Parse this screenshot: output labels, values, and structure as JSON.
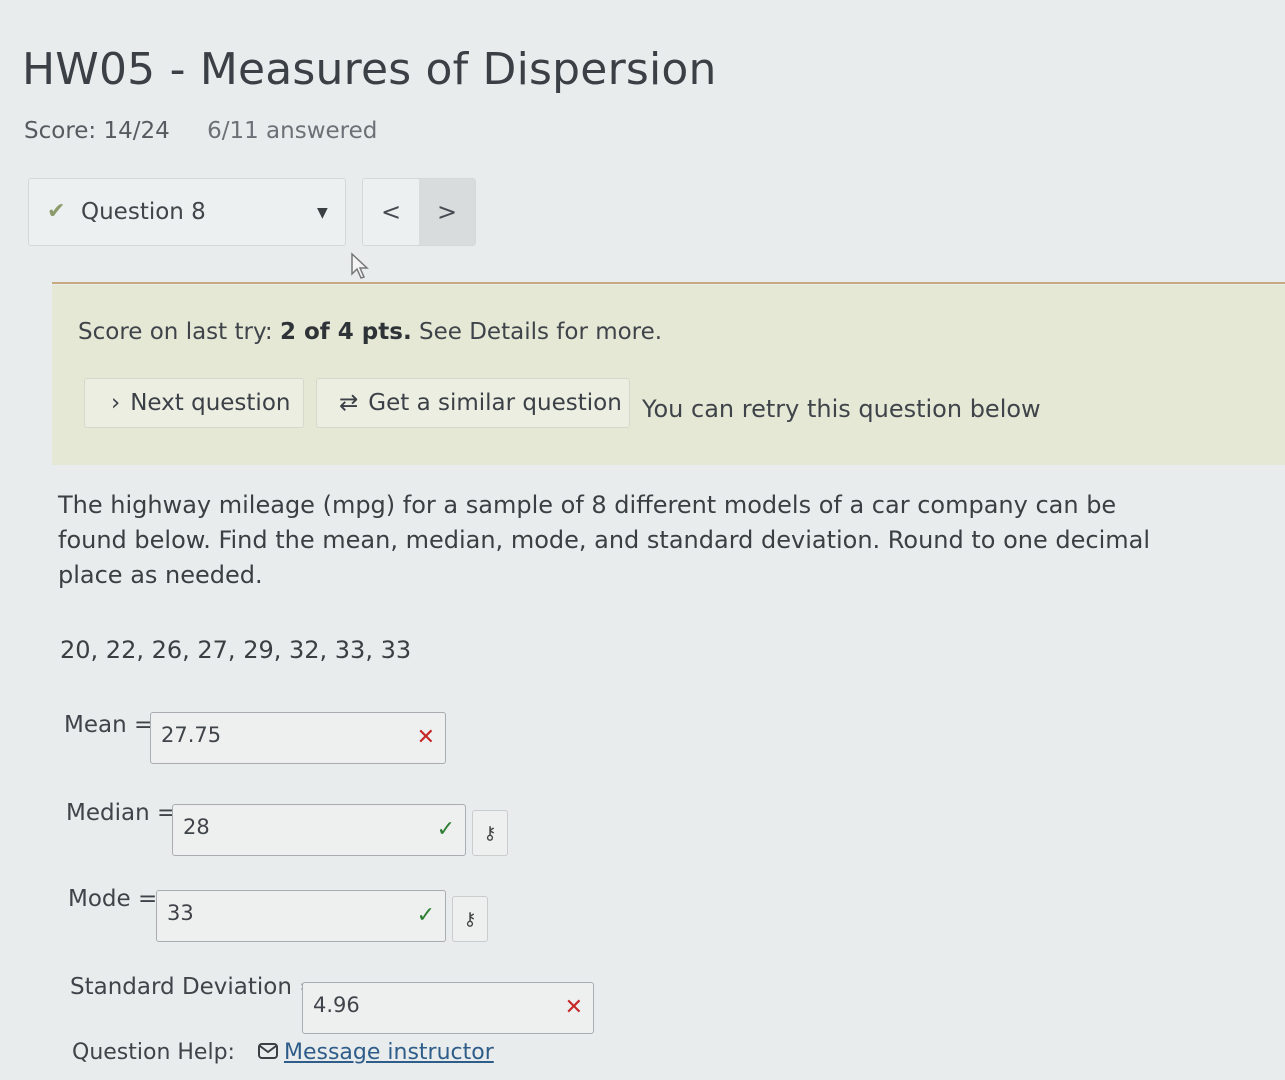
{
  "header": {
    "title": "HW05 - Measures of Dispersion",
    "score": "Score: 14/24",
    "answered": "6/11 answered"
  },
  "nav": {
    "question_label": "Question 8",
    "prev_glyph": "<",
    "next_glyph": ">"
  },
  "banner": {
    "lasttry_prefix": "Score on last try: ",
    "lasttry_score": "2 of 4 pts.",
    "lasttry_suffix": " See Details for more.",
    "next_question": "Next question",
    "similar_question": "Get a similar question",
    "retry_text": "You can retry this question below"
  },
  "question": {
    "prompt": "The highway mileage (mpg) for a sample of 8 different models of a car company can be found below. Find the mean, median, mode, and standard deviation. Round to one decimal place as needed.",
    "dataset": "20, 22, 26, 27, 29, 32, 33, 33"
  },
  "answers": {
    "mean": {
      "label": "Mean =",
      "value": "27.75",
      "status": "wrong"
    },
    "median": {
      "label": "Median =",
      "value": "28",
      "status": "correct"
    },
    "mode": {
      "label": "Mode =",
      "value": "33",
      "status": "correct"
    },
    "sd": {
      "label": "Standard Deviation =",
      "value": "4.96",
      "status": "wrong"
    }
  },
  "help": {
    "label": "Question Help:",
    "message_instructor": "Message instructor"
  },
  "icons": {
    "wrong": "✕",
    "correct": "✓",
    "key": "⚷"
  }
}
